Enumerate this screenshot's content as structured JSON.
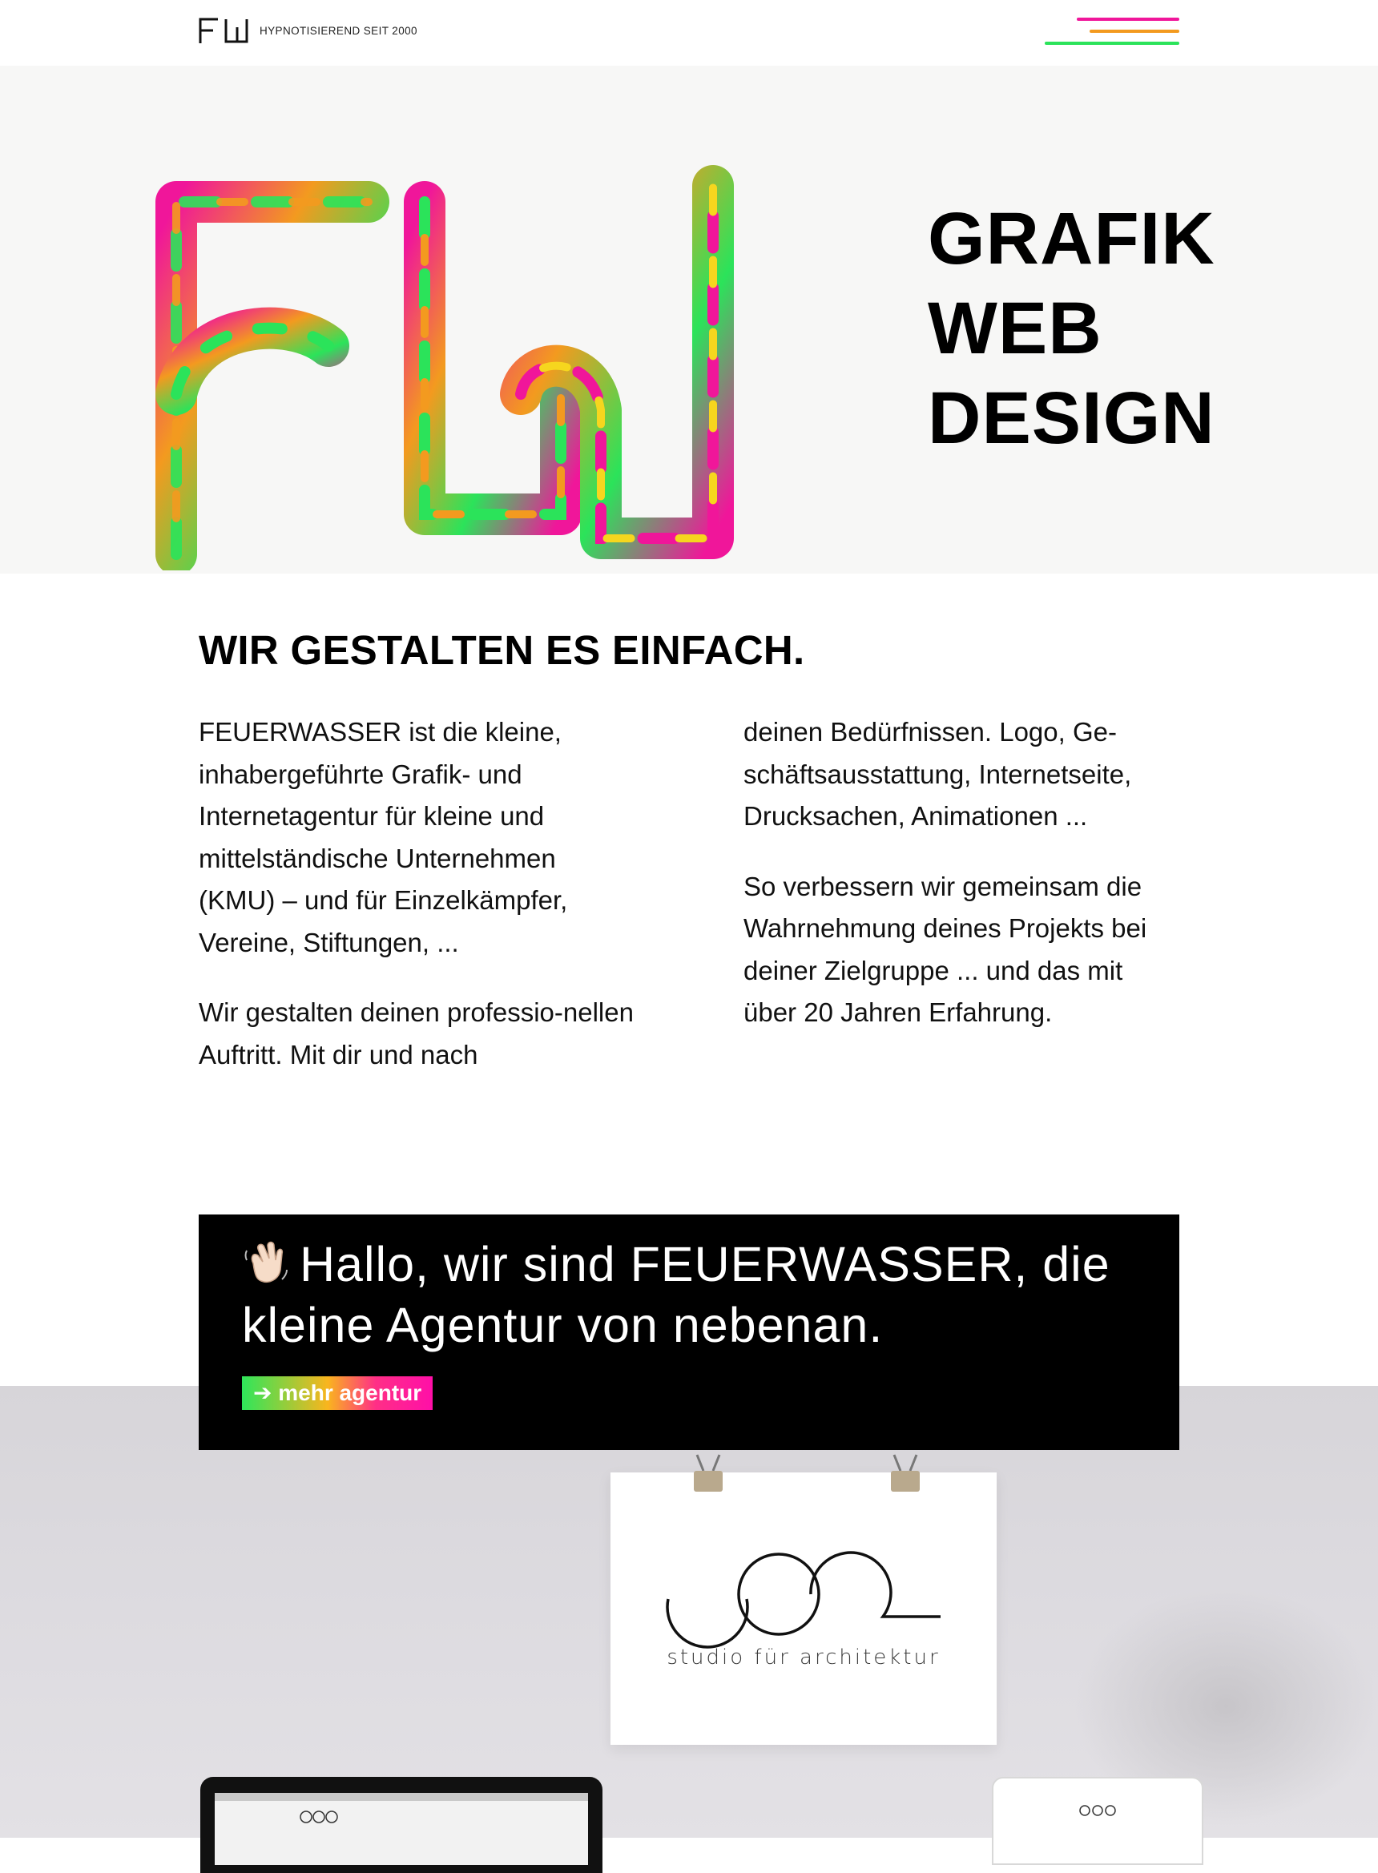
{
  "header": {
    "logo_text": "FW",
    "tagline": "HYPNOTISIEREND SEIT 2000",
    "menu_label": "menu"
  },
  "hero": {
    "art_letters": "FW",
    "title_lines": [
      "GRAFIK",
      "WEB",
      "DESIGN"
    ]
  },
  "intro": {
    "heading": "WIR GESTALTEN ES EINFACH.",
    "col1": [
      "FEUERWASSER ist die kleine, inhabergeführte Grafik- und Internetagentur für kleine und mittelständische Unternehmen (KMU) – und für Einzelkämpfer, Vereine, Stiftungen, ...",
      "Wir gestalten deinen professio-nellen Auftritt. Mit dir und nach"
    ],
    "col2": [
      "deinen Bedürfnissen. Logo, Ge-schäftsausstattung, Internetseite, Drucksachen, Animationen ...",
      "So verbessern wir gemeinsam die Wahrnehmung deines Projekts bei deiner Zielgruppe ... und das mit über 20 Jahren Erfahrung."
    ]
  },
  "callout": {
    "emoji": "👋🏻",
    "text": "Hallo, wir sind FEUERWASSER, die kleine Agentur von nebenan.",
    "button": "➔ mehr agentur"
  },
  "showcase": {
    "poster_text": "studio für architektur"
  },
  "colors": {
    "pink": "#f0169a",
    "orange": "#f39a1f",
    "green": "#2be35a",
    "yellow": "#f6d61e"
  }
}
